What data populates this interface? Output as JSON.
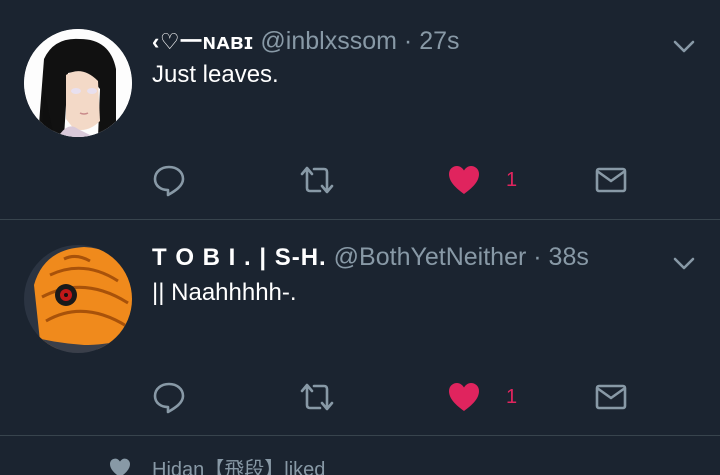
{
  "tweets": [
    {
      "display_name": "‹♡一ɴᴀʙɪ",
      "handle": "@inblxssom",
      "separator": "·",
      "time": "27s",
      "text": "Just leaves.",
      "like_count": "1",
      "liked": true
    },
    {
      "display_name": "T O B I  . | S-H.",
      "handle": "@BothYetNeither",
      "separator": "·",
      "time": "38s",
      "text": "|| Naahhhhh-.",
      "like_count": "1",
      "liked": true
    }
  ],
  "activity": {
    "text": "Hidan【飛段】liked"
  },
  "icons": {
    "reply": "reply-icon",
    "retweet": "retweet-icon",
    "like": "heart-icon",
    "message": "envelope-icon",
    "more": "chevron-down-icon"
  },
  "colors": {
    "background": "#1b2430",
    "divider": "#38444d",
    "secondary_text": "#8899a6",
    "like": "#e0245e"
  }
}
